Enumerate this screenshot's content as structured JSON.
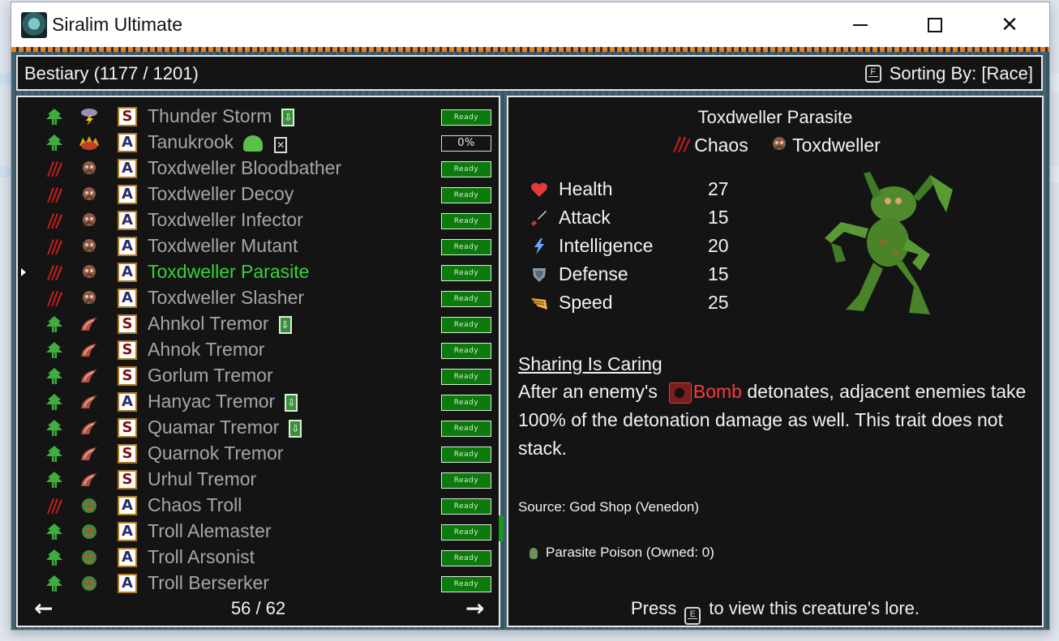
{
  "window": {
    "title": "Siralim Ultimate"
  },
  "header": {
    "title": "Bestiary (1177 / 1201)",
    "sort_key": "F",
    "sort_label": "Sorting By: [Race]"
  },
  "list": {
    "rows": [
      {
        "name": "Thunder Storm",
        "element": "nature",
        "race": "storm",
        "class": "S",
        "extra": "card",
        "status": "Ready",
        "selected": false
      },
      {
        "name": "Tanukrook",
        "element": "nature",
        "race": "tanuki",
        "class": "A",
        "extra": "slime-x",
        "status": "0%",
        "selected": false
      },
      {
        "name": "Toxdweller Bloodbather",
        "element": "chaos",
        "race": "toxdweller",
        "class": "A",
        "extra": "",
        "status": "Ready",
        "selected": false
      },
      {
        "name": "Toxdweller Decoy",
        "element": "chaos",
        "race": "toxdweller",
        "class": "A",
        "extra": "",
        "status": "Ready",
        "selected": false
      },
      {
        "name": "Toxdweller Infector",
        "element": "chaos",
        "race": "toxdweller",
        "class": "A",
        "extra": "",
        "status": "Ready",
        "selected": false
      },
      {
        "name": "Toxdweller Mutant",
        "element": "chaos",
        "race": "toxdweller",
        "class": "A",
        "extra": "",
        "status": "Ready",
        "selected": false
      },
      {
        "name": "Toxdweller Parasite",
        "element": "chaos",
        "race": "toxdweller",
        "class": "A",
        "extra": "",
        "status": "Ready",
        "selected": true
      },
      {
        "name": "Toxdweller Slasher",
        "element": "chaos",
        "race": "toxdweller",
        "class": "A",
        "extra": "",
        "status": "Ready",
        "selected": false
      },
      {
        "name": "Ahnkol Tremor",
        "element": "nature",
        "race": "tremor",
        "class": "S",
        "extra": "card",
        "status": "Ready",
        "selected": false
      },
      {
        "name": "Ahnok Tremor",
        "element": "nature",
        "race": "tremor",
        "class": "S",
        "extra": "",
        "status": "Ready",
        "selected": false
      },
      {
        "name": "Gorlum Tremor",
        "element": "nature",
        "race": "tremor",
        "class": "S",
        "extra": "",
        "status": "Ready",
        "selected": false
      },
      {
        "name": "Hanyac Tremor",
        "element": "nature",
        "race": "tremor",
        "class": "A",
        "extra": "card",
        "status": "Ready",
        "selected": false
      },
      {
        "name": "Quamar Tremor",
        "element": "nature",
        "race": "tremor",
        "class": "S",
        "extra": "card",
        "status": "Ready",
        "selected": false
      },
      {
        "name": "Quarnok Tremor",
        "element": "nature",
        "race": "tremor",
        "class": "S",
        "extra": "",
        "status": "Ready",
        "selected": false
      },
      {
        "name": "Urhul Tremor",
        "element": "nature",
        "race": "tremor",
        "class": "S",
        "extra": "",
        "status": "Ready",
        "selected": false
      },
      {
        "name": "Chaos Troll",
        "element": "chaos",
        "race": "troll",
        "class": "A",
        "extra": "",
        "status": "Ready",
        "selected": false
      },
      {
        "name": "Troll Alemaster",
        "element": "nature",
        "race": "troll",
        "class": "A",
        "extra": "",
        "status": "Ready",
        "selected": false
      },
      {
        "name": "Troll Arsonist",
        "element": "nature",
        "race": "troll",
        "class": "A",
        "extra": "",
        "status": "Ready",
        "selected": false
      },
      {
        "name": "Troll Berserker",
        "element": "nature",
        "race": "troll",
        "class": "A",
        "extra": "",
        "status": "Ready",
        "selected": false
      }
    ],
    "page": "56 / 62",
    "prev_icon": "left-arrow-icon",
    "next_icon": "right-arrow-icon"
  },
  "detail": {
    "name": "Toxdweller Parasite",
    "element": "Chaos",
    "race": "Toxdweller",
    "stats": [
      {
        "icon": "heart-icon",
        "label": "Health",
        "value": "27"
      },
      {
        "icon": "sword-icon",
        "label": "Attack",
        "value": "15"
      },
      {
        "icon": "lightning-icon",
        "label": "Intelligence",
        "value": "20"
      },
      {
        "icon": "shield-icon",
        "label": "Defense",
        "value": "15"
      },
      {
        "icon": "wing-icon",
        "label": "Speed",
        "value": "25"
      }
    ],
    "trait_name": "Sharing Is Caring",
    "trait_pre": "After an enemy's",
    "trait_keyword": "Bomb",
    "trait_post": " detonates, adjacent enemies take 100% of the detonation damage as well. This trait does not stack.",
    "source": "Source: God Shop (Venedon)",
    "item": "Parasite Poison (Owned: 0)",
    "lore_pre": "Press",
    "lore_key": "E",
    "lore_post": "to view this creature's lore."
  },
  "colors": {
    "selected": "#35d435",
    "ready_bg": "#0c7a0c",
    "chaos": "#c21d1d",
    "nature": "#3fae3f",
    "bomb": "#ff3a3a"
  }
}
